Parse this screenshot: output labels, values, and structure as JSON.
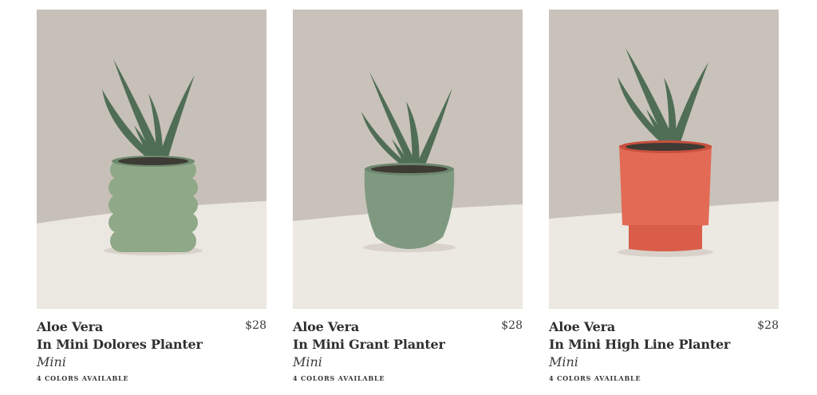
{
  "products": [
    {
      "name": "Aloe Vera",
      "planter": "In Mini Dolores Planter",
      "size": "Mini",
      "price": "$28",
      "colors_available": "4 COLORS AVAILABLE",
      "pot_color": "#8fa888"
    },
    {
      "name": "Aloe Vera",
      "planter": "In Mini Grant Planter",
      "size": "Mini",
      "price": "$28",
      "colors_available": "4 COLORS AVAILABLE",
      "pot_color": "#7f9980"
    },
    {
      "name": "Aloe Vera",
      "planter": "In Mini High Line Planter",
      "size": "Mini",
      "price": "$28",
      "colors_available": "4 COLORS AVAILABLE",
      "pot_color": "#e36a55"
    }
  ]
}
